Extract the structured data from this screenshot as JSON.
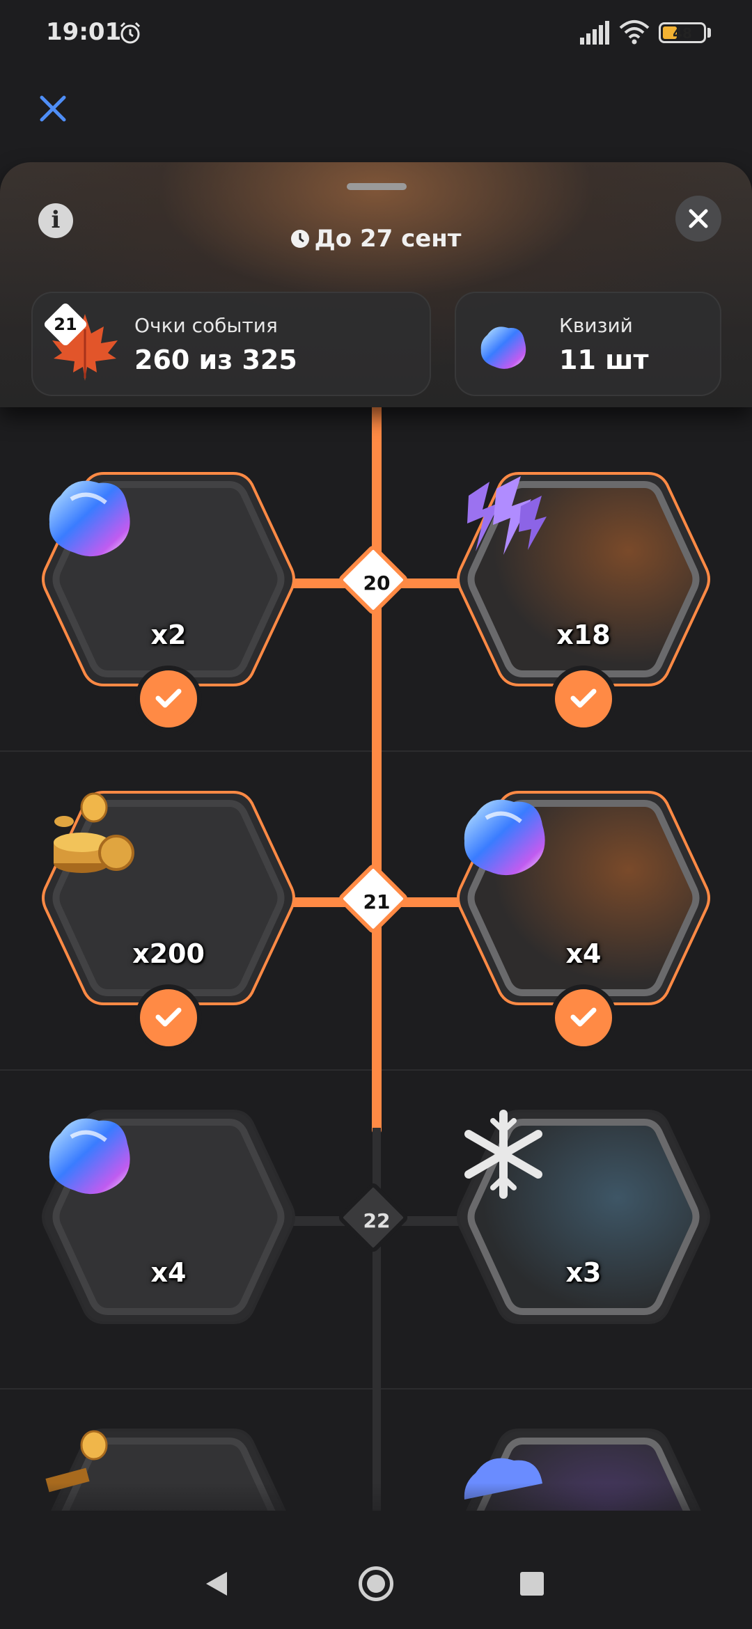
{
  "status_bar": {
    "time": "19:01",
    "battery": "48"
  },
  "header": {
    "deadline": "До 27 сент",
    "event_points": {
      "badge": "21",
      "title": "Очки события",
      "value": "260 из 325"
    },
    "currency": {
      "title": "Квизий",
      "value": "11 шт"
    }
  },
  "levels": [
    {
      "number": "20",
      "completed": true,
      "left": {
        "icon": "crystal-icon",
        "qty": "x2",
        "claimed": true
      },
      "right": {
        "icon": "lightning-icon",
        "qty": "x18",
        "claimed": true
      }
    },
    {
      "number": "21",
      "completed": true,
      "left": {
        "icon": "coins-icon",
        "qty": "x200",
        "claimed": true
      },
      "right": {
        "icon": "crystal-icon",
        "qty": "x4",
        "claimed": true
      }
    },
    {
      "number": "22",
      "completed": false,
      "left": {
        "icon": "crystal-icon",
        "qty": "x4",
        "claimed": false
      },
      "right": {
        "icon": "snowflake-icon",
        "qty": "x3",
        "claimed": false
      }
    }
  ],
  "colors": {
    "accent": "#ff8a45",
    "background": "#1d1d1f",
    "locked": "#2f2f31"
  }
}
